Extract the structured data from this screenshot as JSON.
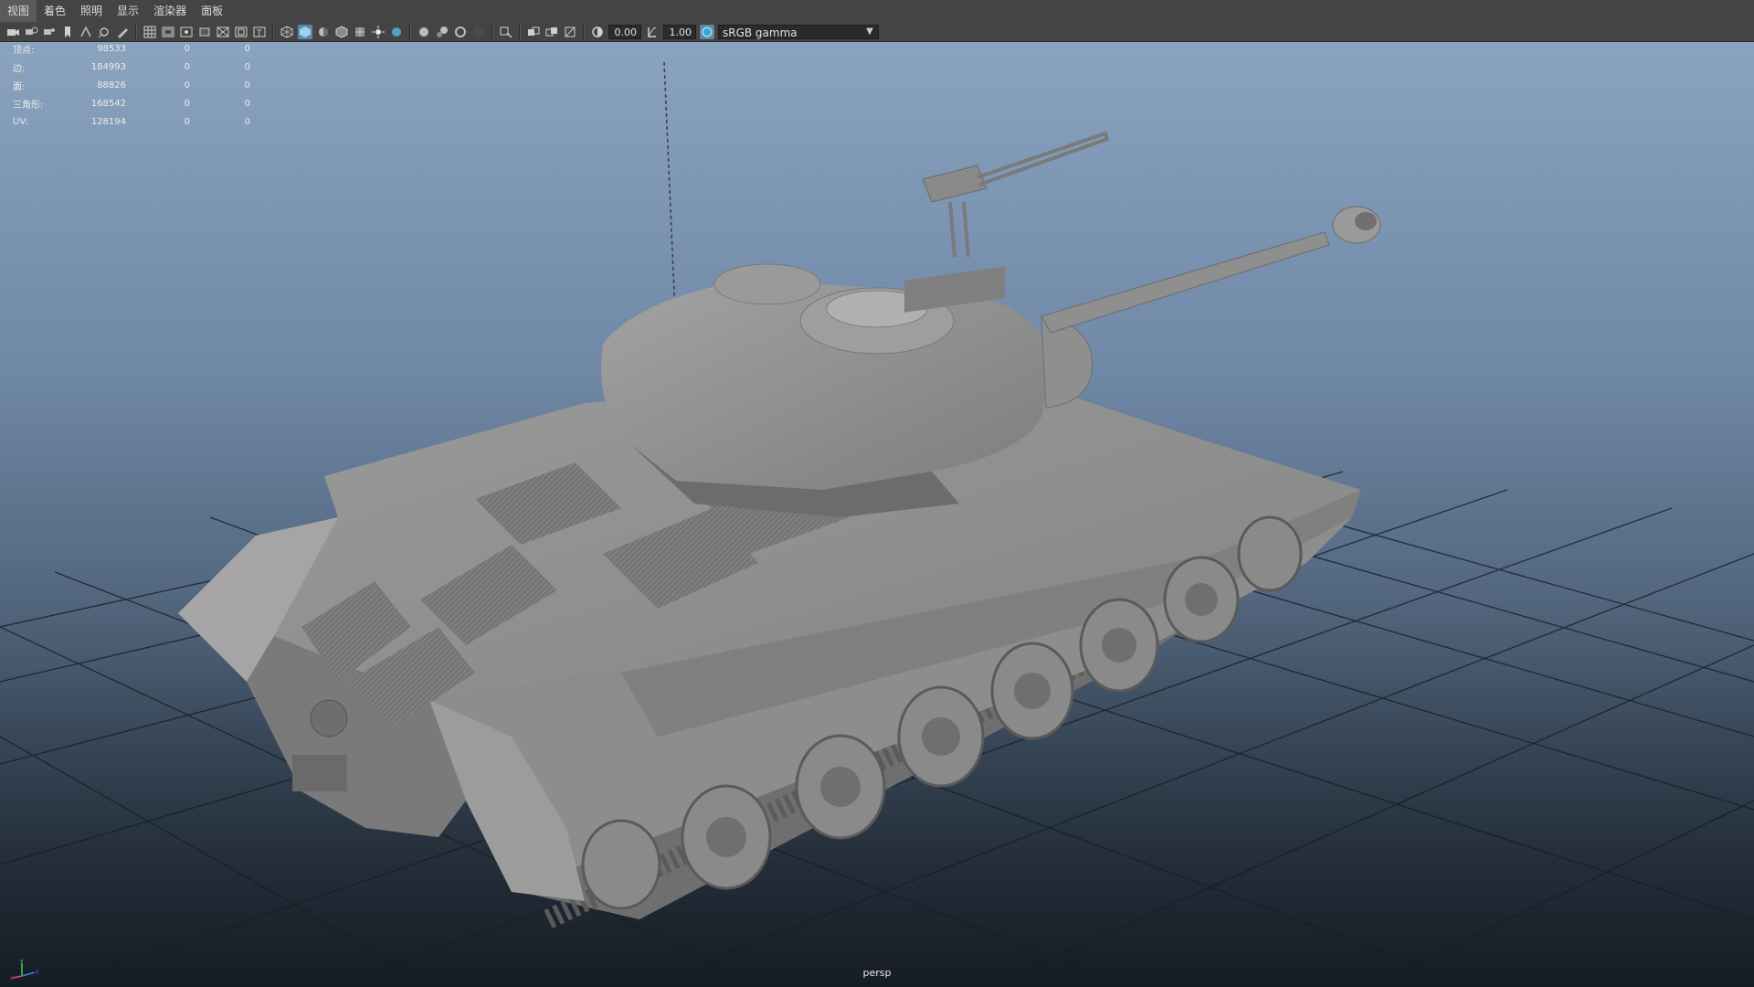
{
  "menubar": {
    "items": [
      "视图",
      "着色",
      "照明",
      "显示",
      "渲染器",
      "面板"
    ]
  },
  "toolbar": {
    "value_a": "0.00",
    "value_b": "1.00",
    "color_space": "sRGB gamma",
    "icons": [
      "camera-icon",
      "camera-attr-icon",
      "bookmark-icon",
      "image-plane-icon",
      "pan-icon",
      "zoom-icon",
      "grease-pencil-icon",
      "grid-icon",
      "film-gate-icon",
      "resolution-gate-icon",
      "gate-mask-icon",
      "field-chart-icon",
      "safe-action-icon",
      "safe-title-icon",
      "wireframe-icon",
      "smooth-shade-icon",
      "default-material-icon",
      "xray-icon",
      "textures-icon",
      "lights-icon",
      "shadows-icon",
      "ao-icon",
      "motion-blur-icon",
      "antialias-icon",
      "depth-of-field-icon",
      "isolate-icon",
      "xray-joints-icon",
      "xray-active-icon",
      "backface-icon",
      "exposure-icon",
      "gamma-icon",
      "color-management-icon"
    ]
  },
  "hud": {
    "rows": [
      {
        "label": "顶点:",
        "value": "98533",
        "c2": "0",
        "c3": "0"
      },
      {
        "label": "边:",
        "value": "184993",
        "c2": "0",
        "c3": "0"
      },
      {
        "label": "面:",
        "value": "88826",
        "c2": "0",
        "c3": "0"
      },
      {
        "label": "三角形:",
        "value": "168542",
        "c2": "0",
        "c3": "0"
      },
      {
        "label": "UV:",
        "value": "128194",
        "c2": "0",
        "c3": "0"
      }
    ]
  },
  "viewport": {
    "camera": "persp",
    "bg_top": "#8aa3bf",
    "bg_bottom": "#1d252f",
    "model_color": "#8c8c8c"
  }
}
